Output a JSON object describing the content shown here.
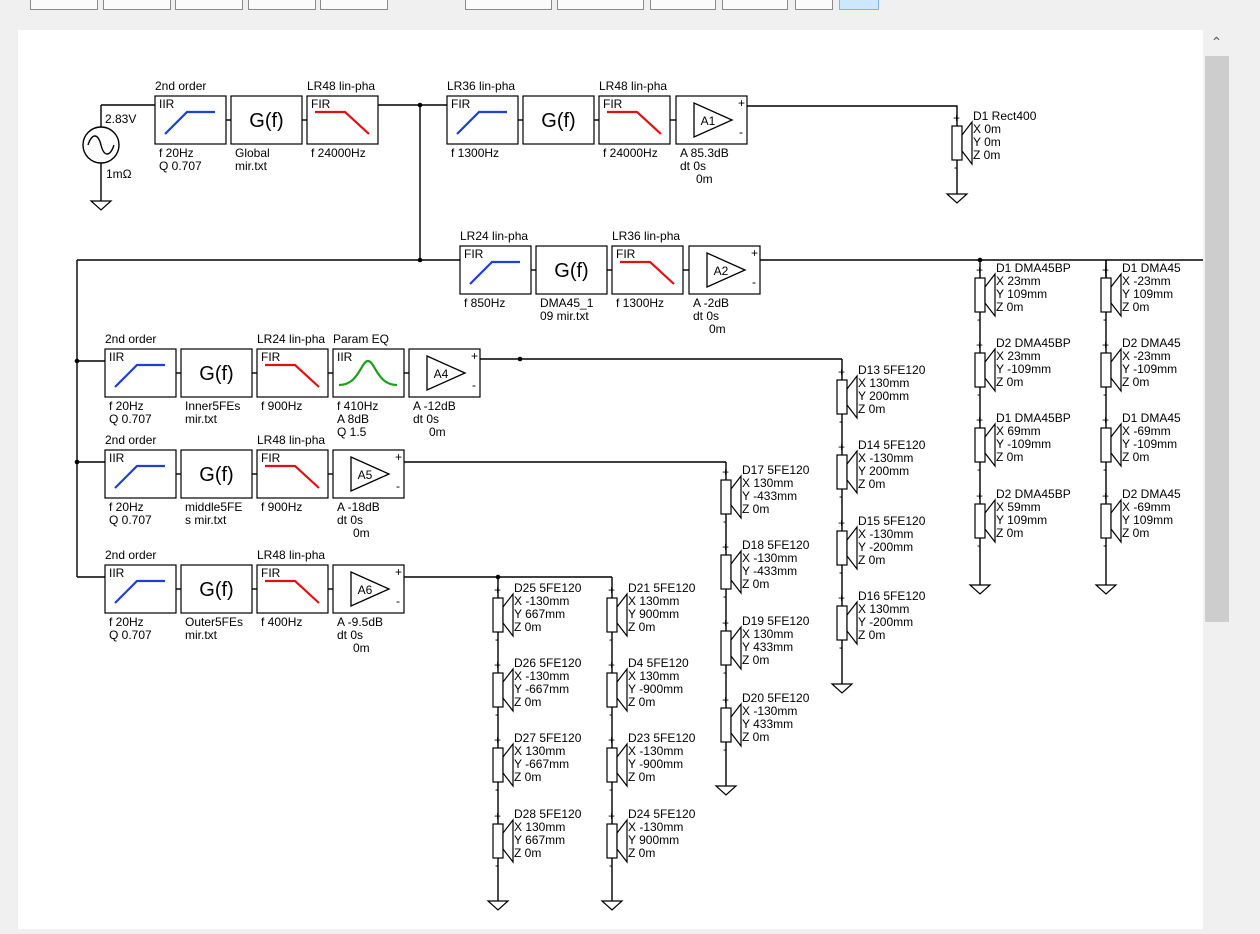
{
  "toolbar": {
    "buttons": [
      "",
      "",
      "",
      "",
      "",
      "",
      "",
      "",
      "",
      "",
      ""
    ]
  },
  "colors": {
    "highpass": "#1f3fd8",
    "lowpass": "#e01010",
    "peq": "#18a018",
    "selected_button": "#cce8ff"
  },
  "source": {
    "voltage": "2.83V",
    "impedance": "1mΩ"
  },
  "row1": {
    "b1": {
      "title": "2nd order",
      "type": "IIR",
      "l1": "f   20Hz",
      "l2": "Q  0.707"
    },
    "b2": {
      "name": "G(f)",
      "l1": "Global",
      "l2": "mir.txt"
    },
    "b3": {
      "title": "LR48 lin-pha",
      "type": "FIR",
      "l1": "f   24000Hz"
    },
    "b4": {
      "title": "LR36 lin-pha",
      "type": "FIR",
      "l1": "f   1300Hz"
    },
    "b5": {
      "name": "G(f)"
    },
    "b6": {
      "title": "LR48 lin-pha",
      "type": "FIR",
      "l1": "f   24000Hz"
    },
    "amp": {
      "name": "A1",
      "l1": "A   85.3dB",
      "l2": "dt  0s",
      "l3": "0m"
    }
  },
  "row2": {
    "b1": {
      "title": "LR24 lin-pha",
      "type": "FIR",
      "l1": "f   850Hz"
    },
    "b2": {
      "name": "G(f)",
      "l1": "DMA45_1",
      "l2": "09 mir.txt"
    },
    "b3": {
      "title": "LR36 lin-pha",
      "type": "FIR",
      "l1": "f   1300Hz"
    },
    "amp": {
      "name": "A2",
      "l1": "A   -2dB",
      "l2": "dt  0s",
      "l3": "0m"
    }
  },
  "row3": {
    "b1": {
      "title": "2nd order",
      "type": "IIR",
      "l1": "f   20Hz",
      "l2": "Q  0.707"
    },
    "b2": {
      "name": "G(f)",
      "l1": "Inner5FEs",
      "l2": "mir.txt"
    },
    "b3": {
      "title": "LR24 lin-pha",
      "type": "FIR",
      "l1": "f   900Hz"
    },
    "b4": {
      "title": "Param EQ",
      "type": "IIR",
      "l1": "f   410Hz",
      "l2": "A   8dB",
      "l3": "Q  1.5"
    },
    "amp": {
      "name": "A4",
      "l1": "A   -12dB",
      "l2": "dt  0s",
      "l3": "0m"
    }
  },
  "row4": {
    "b1": {
      "title": "2nd order",
      "type": "IIR",
      "l1": "f   20Hz",
      "l2": "Q  0.707"
    },
    "b2": {
      "name": "G(f)",
      "l1": "middle5FE",
      "l2": "s mir.txt"
    },
    "b3": {
      "title": "LR48 lin-pha",
      "type": "FIR",
      "l1": "f   900Hz"
    },
    "amp": {
      "name": "A5",
      "l1": "A   -18dB",
      "l2": "dt  0s",
      "l3": "0m"
    }
  },
  "row5": {
    "b1": {
      "title": "2nd order",
      "type": "IIR",
      "l1": "f   20Hz",
      "l2": "Q  0.707"
    },
    "b2": {
      "name": "G(f)",
      "l1": "Outer5FEs",
      "l2": "mir.txt"
    },
    "b3": {
      "title": "LR48 lin-pha",
      "type": "FIR",
      "l1": "f   400Hz"
    },
    "amp": {
      "name": "A6",
      "l1": "A   -9.5dB",
      "l2": "dt  0s",
      "l3": "0m"
    }
  },
  "drivers": {
    "d1_rect": {
      "name": "D1 Rect400",
      "x": "X 0m",
      "y": "Y 0m",
      "z": "Z 0m"
    },
    "dma_c1": [
      {
        "name": "D1 DMA45BP",
        "x": "X 23mm",
        "y": "Y 109mm",
        "z": "Z 0m"
      },
      {
        "name": "D2 DMA45BP",
        "x": "X 23mm",
        "y": "Y -109mm",
        "z": "Z 0m"
      },
      {
        "name": "D1 DMA45BP",
        "x": "X 69mm",
        "y": "Y -109mm",
        "z": "Z 0m"
      },
      {
        "name": "D2 DMA45BP",
        "x": "X 59mm",
        "y": "Y 109mm",
        "z": "Z 0m"
      }
    ],
    "dma_c2": [
      {
        "name": "D1 DMA45",
        "x": "X -23mm",
        "y": "Y 109mm",
        "z": "Z 0m"
      },
      {
        "name": "D2 DMA45",
        "x": "X -23mm",
        "y": "Y -109mm",
        "z": "Z 0m"
      },
      {
        "name": "D1 DMA45",
        "x": "X -69mm",
        "y": "Y -109mm",
        "z": "Z 0m"
      },
      {
        "name": "D2 DMA45",
        "x": "X -69mm",
        "y": "Y 109mm",
        "z": "Z 0m"
      }
    ],
    "inner": [
      {
        "name": "D13 5FE120",
        "x": "X 130mm",
        "y": "Y 200mm",
        "z": "Z 0m"
      },
      {
        "name": "D14 5FE120",
        "x": "X -130mm",
        "y": "Y 200mm",
        "z": "Z 0m"
      },
      {
        "name": "D15 5FE120",
        "x": "X -130mm",
        "y": "Y -200mm",
        "z": "Z 0m"
      },
      {
        "name": "D16 5FE120",
        "x": "X 130mm",
        "y": "Y -200mm",
        "z": "Z 0m"
      }
    ],
    "middle": [
      {
        "name": "D17 5FE120",
        "x": "X 130mm",
        "y": "Y -433mm",
        "z": "Z 0m"
      },
      {
        "name": "D18 5FE120",
        "x": "X -130mm",
        "y": "Y -433mm",
        "z": "Z 0m"
      },
      {
        "name": "D19 5FE120",
        "x": "X 130mm",
        "y": "Y 433mm",
        "z": "Z 0m"
      },
      {
        "name": "D20 5FE120",
        "x": "X -130mm",
        "y": "Y 433mm",
        "z": "Z 0m"
      }
    ],
    "outer_a": [
      {
        "name": "D25 5FE120",
        "x": "X -130mm",
        "y": "Y 667mm",
        "z": "Z 0m"
      },
      {
        "name": "D26 5FE120",
        "x": "X -130mm",
        "y": "Y -667mm",
        "z": "Z 0m"
      },
      {
        "name": "D27 5FE120",
        "x": "X 130mm",
        "y": "Y -667mm",
        "z": "Z 0m"
      },
      {
        "name": "D28 5FE120",
        "x": "X 130mm",
        "y": "Y 667mm",
        "z": "Z 0m"
      }
    ],
    "outer_b": [
      {
        "name": "D21 5FE120",
        "x": "X 130mm",
        "y": "Y 900mm",
        "z": "Z 0m"
      },
      {
        "name": "D4 5FE120",
        "x": "X 130mm",
        "y": "Y -900mm",
        "z": "Z 0m"
      },
      {
        "name": "D23 5FE120",
        "x": "X -130mm",
        "y": "Y -900mm",
        "z": "Z 0m"
      },
      {
        "name": "D24 5FE120",
        "x": "X -130mm",
        "y": "Y 900mm",
        "z": "Z 0m"
      }
    ]
  }
}
